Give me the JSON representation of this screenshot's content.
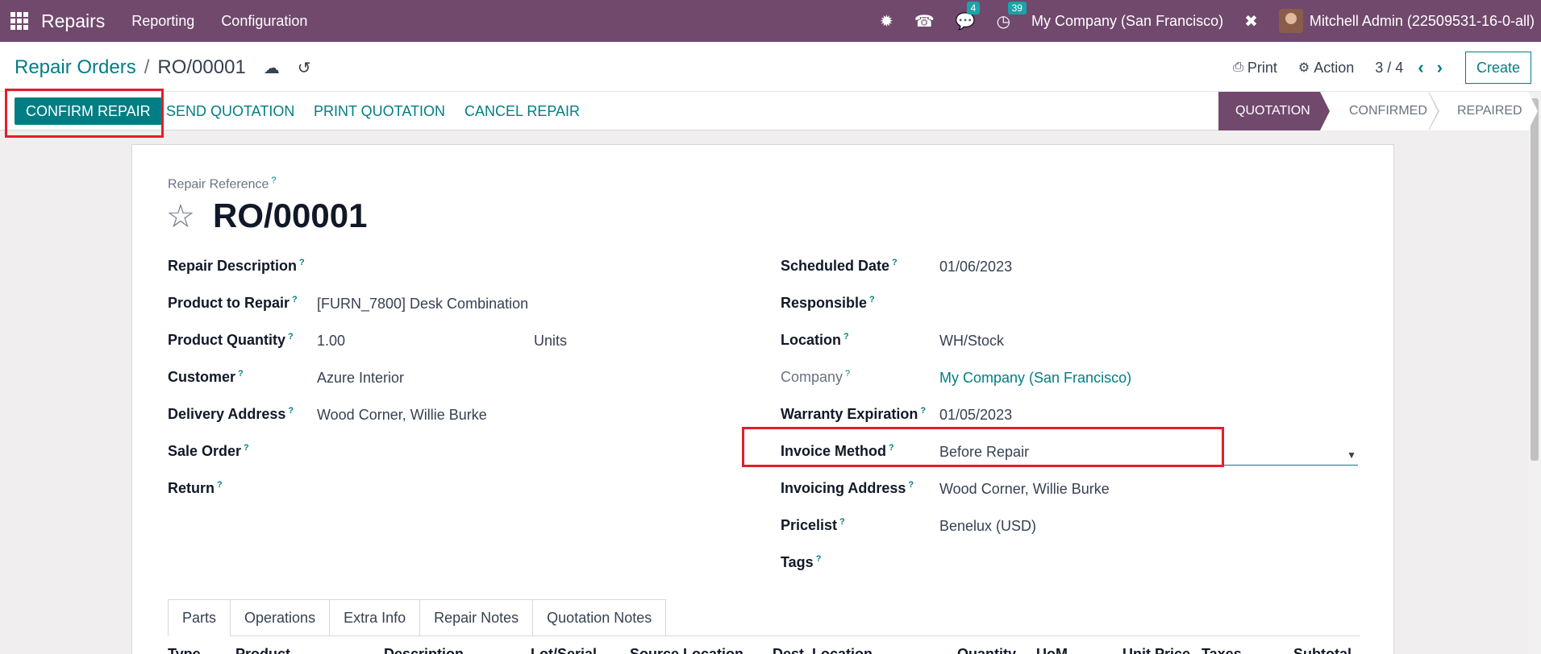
{
  "navbar": {
    "app_name": "Repairs",
    "menus": [
      "Reporting",
      "Configuration"
    ],
    "chat_count": "4",
    "activity_count": "39",
    "company": "My Company (San Francisco)",
    "user": "Mitchell Admin (22509531-16-0-all)"
  },
  "breadcrumb": {
    "parent": "Repair Orders",
    "separator": "/",
    "current": "RO/00001"
  },
  "control": {
    "print": "Print",
    "action": "Action",
    "pager": "3 / 4",
    "create": "Create"
  },
  "actions": {
    "confirm": "CONFIRM REPAIR",
    "send": "SEND QUOTATION",
    "print": "PRINT QUOTATION",
    "cancel": "CANCEL REPAIR"
  },
  "stages": [
    "QUOTATION",
    "CONFIRMED",
    "REPAIRED"
  ],
  "form": {
    "ref_label": "Repair Reference",
    "reference": "RO/00001",
    "left": [
      {
        "label": "Repair Description",
        "value": ""
      },
      {
        "label": "Product to Repair",
        "value": "[FURN_7800] Desk Combination"
      },
      {
        "label": "Product Quantity",
        "value": "1.00",
        "uom": "Units"
      },
      {
        "label": "Customer",
        "value": "Azure Interior"
      },
      {
        "label": "Delivery Address",
        "value": "Wood Corner, Willie Burke"
      },
      {
        "label": "Sale Order",
        "value": ""
      },
      {
        "label": "Return",
        "value": ""
      }
    ],
    "right": [
      {
        "label": "Scheduled Date",
        "value": "01/06/2023"
      },
      {
        "label": "Responsible",
        "value": ""
      },
      {
        "label": "Location",
        "value": "WH/Stock"
      },
      {
        "label": "Company",
        "value": "My Company (San Francisco)"
      },
      {
        "label": "Warranty Expiration",
        "value": "01/05/2023"
      },
      {
        "label": "Invoice Method",
        "value": "Before Repair"
      },
      {
        "label": "Invoicing Address",
        "value": "Wood Corner, Willie Burke"
      },
      {
        "label": "Pricelist",
        "value": "Benelux (USD)"
      },
      {
        "label": "Tags",
        "value": ""
      }
    ]
  },
  "tabs": [
    "Parts",
    "Operations",
    "Extra Info",
    "Repair Notes",
    "Quotation Notes"
  ],
  "columns": [
    "Type",
    "Product",
    "Description",
    "Lot/Serial",
    "Source Location",
    "Dest. Location",
    "Quantity",
    "UoM",
    "Unit Price",
    "Taxes",
    "Subtotal"
  ]
}
